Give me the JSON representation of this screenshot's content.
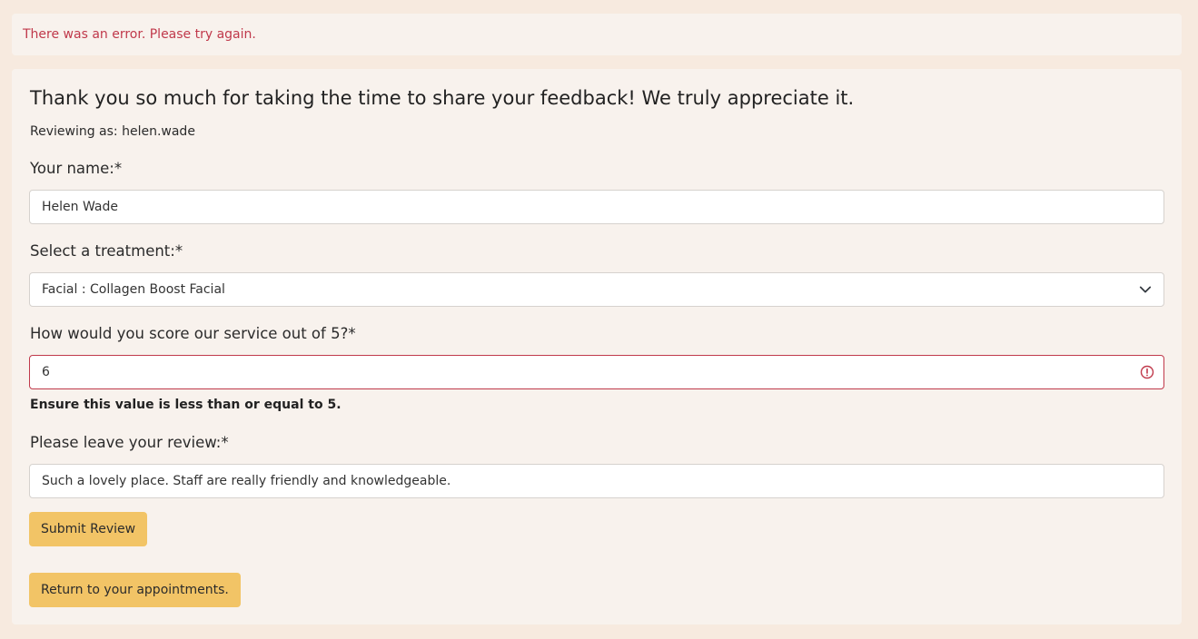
{
  "alert": {
    "message": "There was an error. Please try again."
  },
  "form": {
    "heading": "Thank you so much for taking the time to share your feedback! We truly appreciate it.",
    "reviewing_as": "Reviewing as: helen.wade",
    "name": {
      "label": "Your name:*",
      "value": "Helen Wade"
    },
    "treatment": {
      "label": "Select a treatment:*",
      "selected": "Facial : Collagen Boost Facial"
    },
    "score": {
      "label": "How would you score our service out of 5?*",
      "value": "6",
      "error": "Ensure this value is less than or equal to 5."
    },
    "review": {
      "label": "Please leave your review:*",
      "value": "Such a lovely place. Staff are really friendly and knowledgeable."
    },
    "submit_label": "Submit Review",
    "return_label": "Return to your appointments."
  },
  "colors": {
    "page_bg": "#f7eadf",
    "card_bg": "#f8f2ed",
    "error": "#c0394b",
    "button": "#f2c466"
  }
}
